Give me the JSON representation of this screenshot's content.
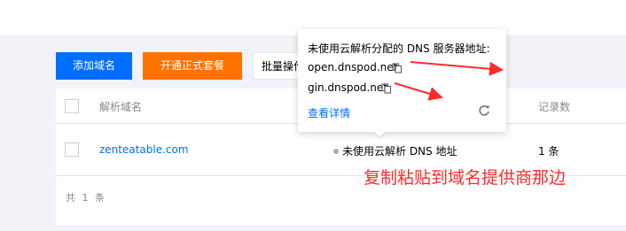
{
  "toolbar": {
    "add_domain": "添加域名",
    "open_formal_package": "开通正式套餐",
    "batch_ops": "批量操作"
  },
  "table": {
    "headers": {
      "domain": "解析域名",
      "records": "记录数"
    },
    "rows": [
      {
        "domain": "zenteatable.com",
        "status": "未使用云解析 DNS 地址",
        "records": "1 条"
      }
    ],
    "total": "共 1 条"
  },
  "popover": {
    "title": "未使用云解析分配的 DNS 服务器地址:",
    "nameservers": [
      "open.dnspod.net",
      "gin.dnspod.net"
    ],
    "details_link": "查看详情"
  },
  "annotation": {
    "text": "复制粘贴到域名提供商那边",
    "color": "#ff2a2a"
  },
  "colors": {
    "primary": "#006eff",
    "orange": "#ff7200",
    "link": "#006eff"
  }
}
